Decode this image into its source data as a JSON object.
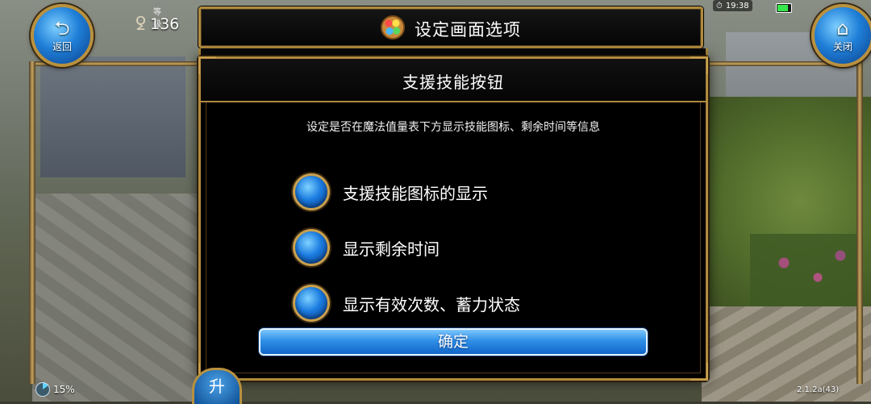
{
  "hud": {
    "back_label": "返回",
    "back_icon": "return-arrow-icon",
    "close_label": "关闭",
    "close_icon": "home-icon",
    "level_label": "等级",
    "level_value": "136",
    "time": "19:38",
    "battery_fraction": 0.9,
    "percent": "15%",
    "version": "2.1.2a(43)",
    "rise_button_label": "升"
  },
  "settings_panel": {
    "title": "设定画面选项",
    "title_icon": "palette-icon"
  },
  "dialog": {
    "title": "支援技能按钮",
    "description": "设定是否在魔法值量表下方显示技能图标、剩余时间等信息",
    "options": [
      {
        "label": "支援技能图标的显示",
        "selected": true
      },
      {
        "label": "显示剩余时间",
        "selected": true
      },
      {
        "label": "显示有效次数、蓄力状态",
        "selected": true
      }
    ],
    "confirm_label": "确定"
  },
  "colors": {
    "frame_gold": "#b08a3e",
    "button_blue": "#1b7ce0",
    "panel_bg": "#000000"
  }
}
